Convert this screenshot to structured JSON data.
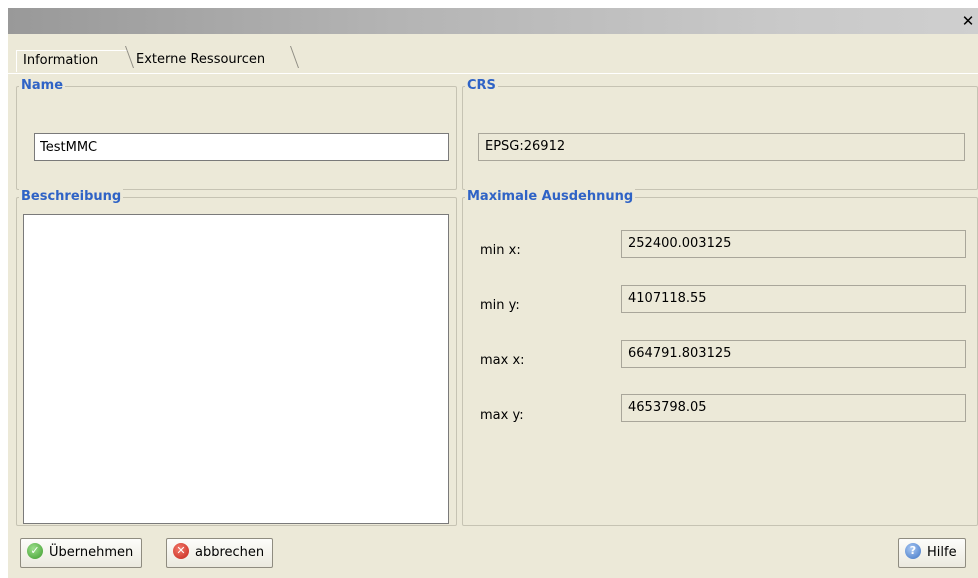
{
  "window": {
    "close_glyph": "✕"
  },
  "tabs": [
    {
      "label": "Information",
      "active": true
    },
    {
      "label": "Externe Ressourcen",
      "active": false
    }
  ],
  "name_group": {
    "title": "Name",
    "value": "TestMMC"
  },
  "crs_group": {
    "title": "CRS",
    "value": "EPSG:26912"
  },
  "description_group": {
    "title": "Beschreibung",
    "value": ""
  },
  "extent_group": {
    "title": "Maximale Ausdehnung",
    "min_x": {
      "label": "min x:",
      "value": "252400.003125"
    },
    "min_y": {
      "label": "min y:",
      "value": "4107118.55"
    },
    "max_x": {
      "label": "max x:",
      "value": "664791.803125"
    },
    "max_y": {
      "label": "max y:",
      "value": "4653798.05"
    }
  },
  "buttons": {
    "apply": {
      "label": "Übernehmen",
      "icon": "check-circle-icon"
    },
    "cancel": {
      "label": "abbrechen",
      "icon": "cancel-circle-icon"
    },
    "help": {
      "label": "Hilfe",
      "icon": "help-circle-icon"
    }
  },
  "colors": {
    "group_title": "#2f63c6",
    "background": "#ece9d8"
  }
}
